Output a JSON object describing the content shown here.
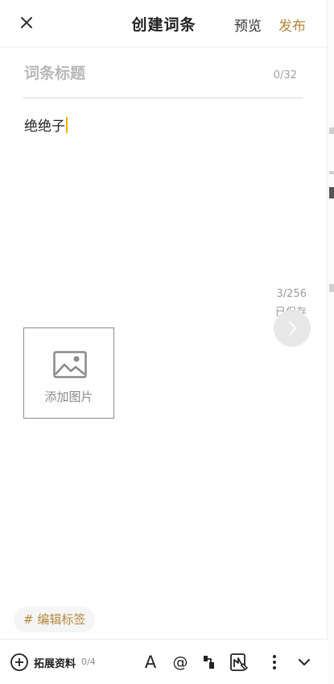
{
  "header": {
    "title": "创建词条",
    "preview_label": "预览",
    "publish_label": "发布"
  },
  "entry_title": {
    "placeholder": "词条标题",
    "value": "",
    "count": "0/32"
  },
  "body": {
    "text": "绝绝子",
    "count": "3/256",
    "status": "已保存"
  },
  "add_image": {
    "label": "添加图片"
  },
  "tag": {
    "label": "# 编辑标签"
  },
  "toolbar": {
    "expand_label": "拓展资料",
    "expand_count": "0/4",
    "font_label": "A",
    "mention_label": "@"
  },
  "colors": {
    "accent": "#b5873c",
    "cursor": "#f0b400"
  }
}
